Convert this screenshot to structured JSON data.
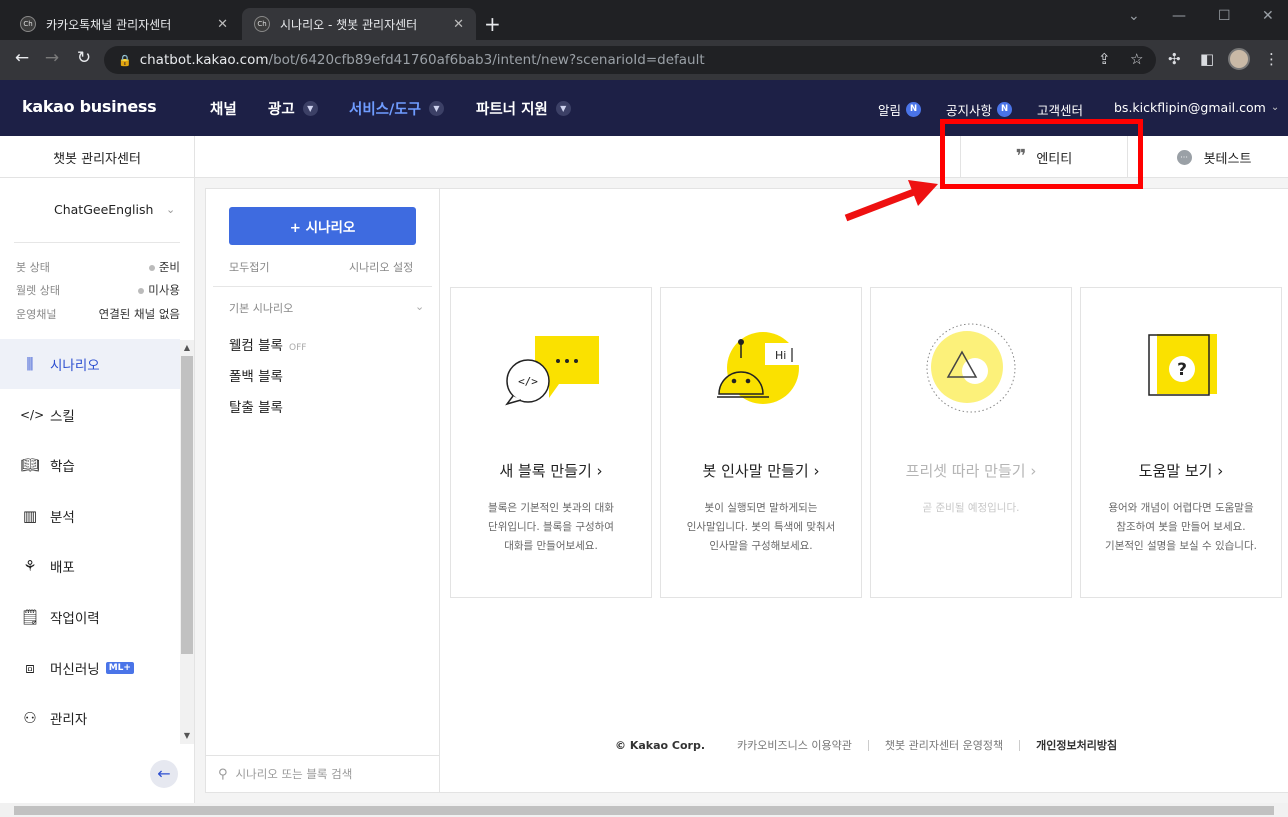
{
  "browser": {
    "tabs": [
      {
        "title": "카카오톡채널 관리자센터",
        "favicon": "Ch"
      },
      {
        "title": "시나리오 - 챗봇 관리자센터",
        "favicon": "Ch"
      }
    ],
    "url_host": "chatbot.kakao.com",
    "url_path": "/bot/6420cfb89efd41760af6bab3/intent/new?scenarioId=default"
  },
  "header": {
    "logo": "kakao business",
    "nav": [
      {
        "label": "채널"
      },
      {
        "label": "광고"
      },
      {
        "label": "서비스/도구"
      },
      {
        "label": "파트너 지원"
      }
    ],
    "alerts": "알림",
    "notices": "공지사항",
    "new_badge": "N",
    "support": "고객센터",
    "account": "bs.kickflipin@gmail.com"
  },
  "subheader": {
    "title": "챗봇 관리자센터",
    "entity_tab": "엔티티",
    "bottest_tab": "봇테스트"
  },
  "sidebar": {
    "bot_name": "ChatGeeEnglish",
    "status": [
      {
        "label": "봇 상태",
        "value": "준비"
      },
      {
        "label": "월렛 상태",
        "value": "미사용"
      },
      {
        "label": "운영채널",
        "value": "연결된 채널 없음"
      }
    ],
    "menu": [
      {
        "label": "시나리오"
      },
      {
        "label": "스킬"
      },
      {
        "label": "학습"
      },
      {
        "label": "분석"
      },
      {
        "label": "배포"
      },
      {
        "label": "작업이력"
      },
      {
        "label": "머신러닝"
      },
      {
        "label": "관리자"
      }
    ],
    "ml_tag": "ML+"
  },
  "scenarios": {
    "add_button": "+ 시나리오",
    "collapse_all": "모두접기",
    "settings": "시나리오 설정",
    "group": "기본 시나리오",
    "blocks": [
      {
        "label": "웰컴 블록",
        "tag": "OFF"
      },
      {
        "label": "폴백 블록",
        "tag": ""
      },
      {
        "label": "탈출 블록",
        "tag": ""
      }
    ],
    "search_placeholder": "시나리오 또는 블록 검색"
  },
  "cards": [
    {
      "title": "새 블록 만들기 ›",
      "desc_lines": [
        "블록은 기본적인 봇과의 대화",
        "단위입니다. 블록을 구성하여",
        "대화를 만들어보세요."
      ]
    },
    {
      "title": "봇 인사말 만들기 ›",
      "desc_lines": [
        "봇이 실행되면 말하게되는",
        "인사말입니다. 봇의 특색에 맞춰서",
        "인사말을 구성해보세요."
      ]
    },
    {
      "title": "프리셋 따라 만들기 ›",
      "desc_lines": [
        "곧 준비될 예정입니다."
      ]
    },
    {
      "title": "도움말 보기 ›",
      "desc_lines": [
        "용어와 개념이 어렵다면 도움말을",
        "참조하여 봇을 만들어 보세요.",
        "기본적인 설명을 보실 수 있습니다."
      ]
    }
  ],
  "footer": {
    "copyright": "© Kakao Corp.",
    "terms": "카카오비즈니스 이용약관",
    "policy": "챗봇 관리자센터 운영정책",
    "privacy": "개인정보처리방침"
  },
  "colors": {
    "header_bg": "#1d2046",
    "accent": "#3e6be0",
    "yellow": "#fae100",
    "highlight": "#ff0000"
  }
}
